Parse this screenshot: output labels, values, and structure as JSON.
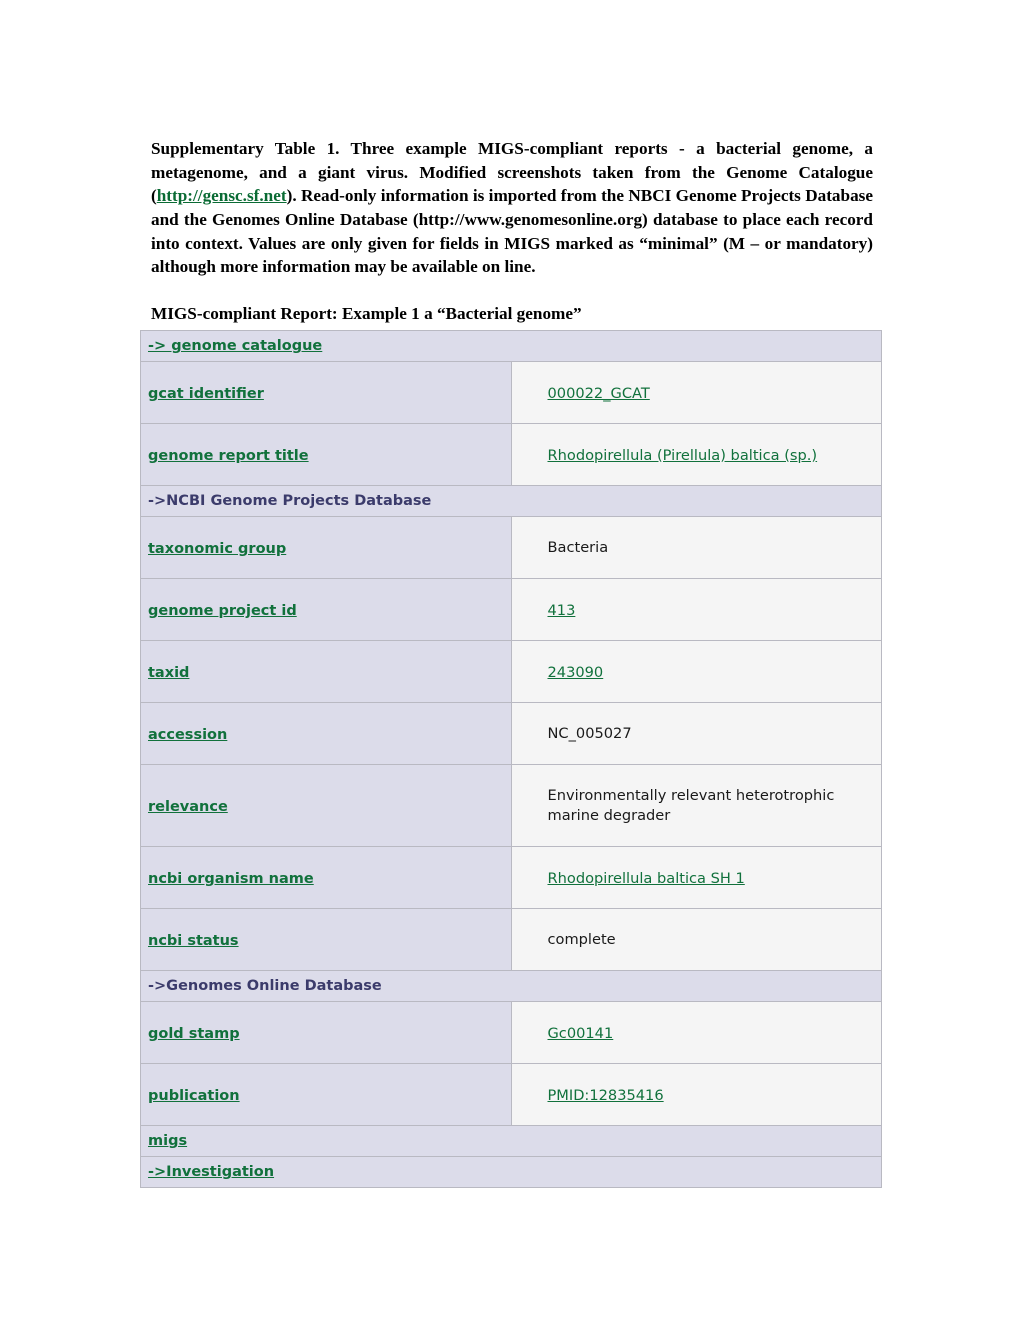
{
  "caption": {
    "part1": "Supplementary Table 1.   Three example MIGS-compliant reports - a bacterial genome, a metagenome, and a giant virus.   Modified screenshots taken from the Genome Catalogue (",
    "link_text": "http://gensc.sf.net",
    "part2": ").   Read-only information is imported from the NBCI Genome Projects Database and the Genomes Online Database (http://www.genomesonline.org) database to place each record into context.   Values are only given for fields in MIGS marked as “minimal” (M – or mandatory) although more information may be available on line."
  },
  "subtitle": "MIGS-compliant Report: Example 1 a “Bacterial genome”",
  "colors": {
    "link_green": "#11713c",
    "section_navy": "#3b3b6b",
    "label_bg": "#dcdcea",
    "value_bg": "#f5f5f5",
    "border": "#b9b9c2"
  },
  "table": {
    "rows": [
      {
        "kind": "section",
        "style": "green",
        "label": "-> genome catalogue"
      },
      {
        "kind": "data",
        "label": "gcat identifier",
        "value": "000022_GCAT",
        "value_kind": "link"
      },
      {
        "kind": "data",
        "label": "genome report title",
        "value": "Rhodopirellula (Pirellula) baltica (sp.)",
        "value_kind": "link"
      },
      {
        "kind": "section",
        "style": "navy",
        "label": "->NCBI Genome Projects Database"
      },
      {
        "kind": "data",
        "label": "taxonomic group",
        "value": "Bacteria",
        "value_kind": "text"
      },
      {
        "kind": "data",
        "label": "genome project id",
        "value": "413",
        "value_kind": "link"
      },
      {
        "kind": "data",
        "label": "taxid",
        "value": "243090",
        "value_kind": "link"
      },
      {
        "kind": "data",
        "label": "accession",
        "value": "NC_005027",
        "value_kind": "text"
      },
      {
        "kind": "data",
        "label": "relevance",
        "value": "Environmentally relevant heterotrophic marine degrader",
        "value_kind": "text",
        "tall": true
      },
      {
        "kind": "data",
        "label": "ncbi organism name",
        "value": "Rhodopirellula baltica SH 1",
        "value_kind": "link"
      },
      {
        "kind": "data",
        "label": "ncbi status",
        "value": "complete",
        "value_kind": "text"
      },
      {
        "kind": "section",
        "style": "navy",
        "label": "->Genomes Online Database"
      },
      {
        "kind": "data",
        "label": "gold stamp",
        "value": "Gc00141",
        "value_kind": "link"
      },
      {
        "kind": "data",
        "label": "publication",
        "value": "PMID:12835416",
        "value_kind": "link"
      },
      {
        "kind": "section",
        "style": "green",
        "label": "migs"
      },
      {
        "kind": "section",
        "style": "green",
        "label": "->Investigation"
      }
    ]
  }
}
